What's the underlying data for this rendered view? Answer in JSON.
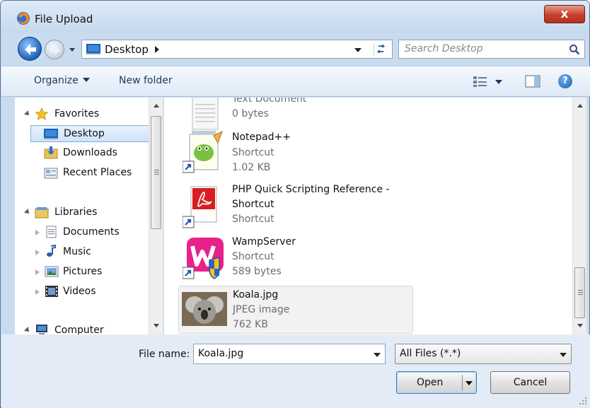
{
  "window": {
    "title": "File Upload",
    "close_label": "x"
  },
  "address": {
    "location": "Desktop"
  },
  "search": {
    "placeholder": "Search Desktop"
  },
  "toolbar": {
    "organize_label": "Organize",
    "new_folder_label": "New folder",
    "help_label": "?"
  },
  "navigation": {
    "favorites": {
      "label": "Favorites",
      "items": [
        {
          "label": "Desktop",
          "selected": true,
          "icon": "desktop-icon"
        },
        {
          "label": "Downloads",
          "icon": "downloads-icon"
        },
        {
          "label": "Recent Places",
          "icon": "recent-places-icon"
        }
      ]
    },
    "libraries": {
      "label": "Libraries",
      "items": [
        {
          "label": "Documents",
          "icon": "documents-icon"
        },
        {
          "label": "Music",
          "icon": "music-icon"
        },
        {
          "label": "Pictures",
          "icon": "pictures-icon"
        },
        {
          "label": "Videos",
          "icon": "videos-icon"
        }
      ]
    },
    "computer": {
      "label": "Computer"
    }
  },
  "files": [
    {
      "name": "",
      "type": "Text Document",
      "size": "0 bytes",
      "icon": "text-document-icon"
    },
    {
      "name": "Notepad++",
      "type": "Shortcut",
      "size": "1.02 KB",
      "icon": "notepad-plus-plus-icon"
    },
    {
      "name": "PHP Quick Scripting Reference -",
      "name_line2": "Shortcut",
      "type": "Shortcut",
      "icon": "pdf-icon"
    },
    {
      "name": "WampServer",
      "type": "Shortcut",
      "size": "589 bytes",
      "icon": "wampserver-icon"
    },
    {
      "name": "Koala.jpg",
      "type": "JPEG image",
      "size": "762 KB",
      "icon": "koala-thumbnail",
      "selected": true
    }
  ],
  "bottom": {
    "file_name_label": "File name:",
    "file_name_value": "Koala.jpg",
    "filter_value": "All Files (*.*)",
    "open_label": "Open",
    "cancel_label": "Cancel"
  },
  "colors": {
    "frame": "#c9dcef",
    "selection": "#cde3fb",
    "close": "#c7402b"
  }
}
